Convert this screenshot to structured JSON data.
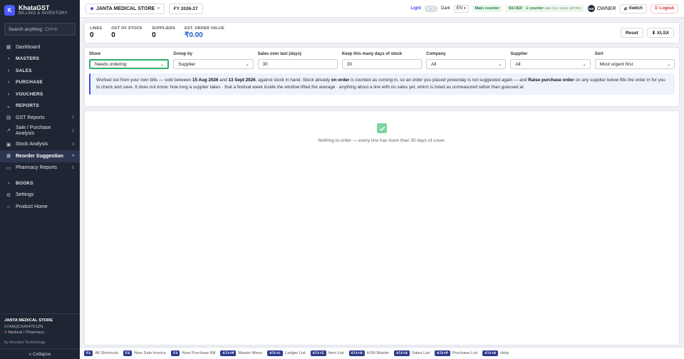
{
  "app": {
    "name": "KhataGST",
    "subtitle": "BILLING & INVENTORY",
    "logo_letter": "K"
  },
  "sidebar": {
    "search": {
      "placeholder": "Search anything",
      "shortcut": "Ctrl+K"
    },
    "items": [
      {
        "label": "Dashboard",
        "icon": "grid-icon"
      },
      {
        "label": "MASTERS",
        "icon": "chevron-right-icon"
      },
      {
        "label": "SALES",
        "icon": "chevron-right-icon"
      },
      {
        "label": "PURCHASE",
        "icon": "chevron-right-icon"
      },
      {
        "label": "VOUCHERS",
        "icon": "chevron-right-icon"
      },
      {
        "label": "REPORTS",
        "icon": "chevron-down-icon"
      },
      {
        "label": "GST Reports",
        "count": "1",
        "icon": "receipt-icon"
      },
      {
        "label": "Sale / Purchase Analysis",
        "count": "2",
        "icon": "trend-icon"
      },
      {
        "label": "Stock Analysis",
        "count": "3",
        "icon": "box-icon"
      },
      {
        "label": "Reorder Suggestion",
        "count": "4",
        "icon": "cart-icon"
      },
      {
        "label": "Pharmacy Reports",
        "count": "5",
        "icon": "doc-icon"
      },
      {
        "label": "BOOKS",
        "icon": "chevron-right-icon"
      },
      {
        "label": "Settings",
        "icon": "gear-icon"
      },
      {
        "label": "Product Home",
        "icon": "home-icon"
      }
    ],
    "footer": {
      "store": "JANTA MEDICAL STORE",
      "gstin": "27AAQCS4547K1ZN",
      "category": "Medical / Pharmacy",
      "by": "by Anedya Technology",
      "collapse": "« Collapse"
    }
  },
  "topbar": {
    "store": "JANTA MEDICAL STORE",
    "fy": "FY 2026-27",
    "theme_light": "Light",
    "theme_dark": "Dark",
    "lang": "EN",
    "counter_main": "Main counter",
    "counter_silver": "SILVER · 1 counter",
    "license": "ANS-SLV-2026-4E7F97",
    "owner_initials": "OW",
    "owner": "OWNER",
    "switch": "Switch",
    "logout": "Logout"
  },
  "stats": {
    "lines": {
      "label": "LINES",
      "value": "0"
    },
    "out_of_stock": {
      "label": "OUT OF STOCK",
      "value": "0"
    },
    "suppliers": {
      "label": "SUPPLIERS",
      "value": "0"
    },
    "order_value": {
      "label": "EST. ORDER VALUE",
      "value": "₹0.00"
    },
    "reset": "Reset",
    "xlsx": "⬇ XLSX"
  },
  "filters": {
    "show": {
      "label": "Show",
      "value": "Needs ordering"
    },
    "group_by": {
      "label": "Group by",
      "value": "Supplier"
    },
    "sales_over": {
      "label": "Sales over last (days)",
      "value": "30"
    },
    "keep_days": {
      "label": "Keep this many days of stock",
      "value": "30"
    },
    "company": {
      "label": "Company",
      "value": "All"
    },
    "supplier": {
      "label": "Supplier",
      "value": "All"
    },
    "sort": {
      "label": "Sort",
      "value": "Most urgent first"
    }
  },
  "info": {
    "p1": "Worked out from your own bills — sold between ",
    "date_from": "15 Aug 2026",
    "p2": " and ",
    "date_to": "13 Sept 2026",
    "p3": ", against stock in hand. Stock already ",
    "on_order": "on order",
    "p4": " is counted as coming in, so an order you placed yesterday is not suggested again — and ",
    "raise": "Raise purchase order",
    "p5": " on any supplier below fills the order in for you to check and save. It does not know: how long a supplier takes · that a festival week inside the window lifted the average · anything about a line with no sales yet, which is listed as unmeasured rather than guessed at."
  },
  "empty": {
    "message": "Nothing to order — every line has more than 30 days of cover."
  },
  "shortcuts": [
    {
      "key": "F1",
      "label": "All Shortcuts"
    },
    {
      "key": "F2",
      "label": "New Sale Invoice"
    },
    {
      "key": "F3",
      "label": "New Purchase Bill"
    },
    {
      "key": "Alt+M",
      "label": "Master Menu"
    },
    {
      "key": "Alt+L",
      "label": "Ledger List"
    },
    {
      "key": "Alt+I",
      "label": "Item List"
    },
    {
      "key": "Alt+H",
      "label": "HSN Master"
    },
    {
      "key": "Alt+S",
      "label": "Sales List"
    },
    {
      "key": "Alt+P",
      "label": "Purchase List"
    },
    {
      "key": "Alt+A",
      "label": "Help"
    }
  ]
}
